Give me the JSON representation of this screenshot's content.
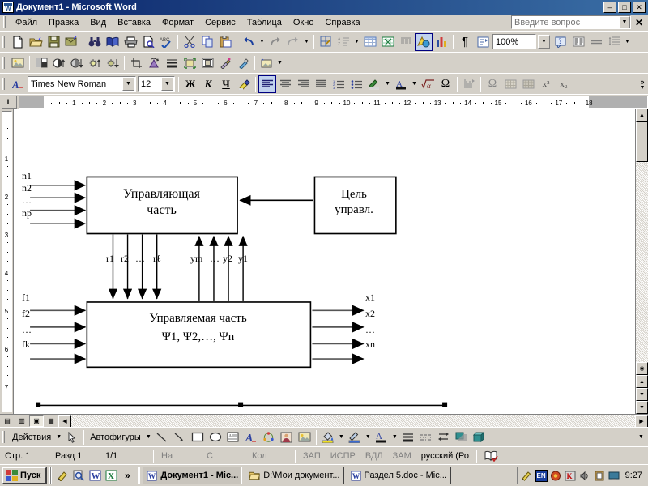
{
  "window": {
    "title": "Документ1 - Microsoft Word",
    "app_icon": "word-document-icon",
    "minimize": "–",
    "maximize": "□",
    "close": "✕"
  },
  "menu": {
    "items": [
      {
        "label": "Файл",
        "accel": "Ф"
      },
      {
        "label": "Правка",
        "accel": "р"
      },
      {
        "label": "Вид",
        "accel": "В"
      },
      {
        "label": "Вставка",
        "accel": "с"
      },
      {
        "label": "Формат",
        "accel": "м"
      },
      {
        "label": "Сервис",
        "accel": "е"
      },
      {
        "label": "Таблица",
        "accel": "Т"
      },
      {
        "label": "Окно",
        "accel": "О"
      },
      {
        "label": "Справка",
        "accel": "С"
      }
    ],
    "ask_placeholder": "Введите вопрос",
    "close_doc": "✕"
  },
  "standard_toolbar": {
    "buttons": [
      {
        "name": "new-document-icon"
      },
      {
        "name": "open-folder-icon"
      },
      {
        "name": "save-icon"
      },
      {
        "name": "email-icon"
      },
      {
        "name": "search-binoculars-icon"
      },
      {
        "name": "read-book-icon"
      },
      {
        "name": "print-icon"
      },
      {
        "name": "print-preview-icon"
      },
      {
        "name": "spelling-check-icon"
      },
      {
        "name": "cut-scissors-icon"
      },
      {
        "name": "copy-icon"
      },
      {
        "name": "paste-clipboard-icon"
      },
      {
        "name": "undo-icon"
      },
      {
        "name": "redo-icon"
      },
      {
        "name": "insert-hyperlink-icon"
      },
      {
        "name": "tables-and-borders-icon"
      },
      {
        "name": "insert-table-icon"
      },
      {
        "name": "insert-excel-sheet-icon"
      },
      {
        "name": "columns-icon"
      },
      {
        "name": "drawing-icon"
      },
      {
        "name": "document-map-icon"
      },
      {
        "name": "show-formatting-marks-icon"
      },
      {
        "name": "research-icon"
      },
      {
        "name": "help-icon"
      },
      {
        "name": "reading-layout-icon"
      },
      {
        "name": "equals-icon"
      },
      {
        "name": "paragraph-spacing-icon"
      }
    ],
    "zoom_value": "100%"
  },
  "picture_toolbar": {
    "buttons": [
      {
        "name": "insert-picture-icon"
      },
      {
        "name": "color-mode-icon"
      },
      {
        "name": "more-contrast-icon"
      },
      {
        "name": "less-contrast-icon"
      },
      {
        "name": "more-brightness-icon"
      },
      {
        "name": "less-brightness-icon"
      },
      {
        "name": "crop-icon"
      },
      {
        "name": "rotate-left-icon"
      },
      {
        "name": "line-style-icon"
      },
      {
        "name": "compress-pictures-icon"
      },
      {
        "name": "text-wrapping-icon"
      },
      {
        "name": "format-picture-icon"
      },
      {
        "name": "set-transparent-color-icon"
      },
      {
        "name": "reset-picture-icon"
      }
    ]
  },
  "formatting_toolbar": {
    "styles_icon": "styles-and-formatting-icon",
    "font_name": "Times New Roman",
    "font_size": "12",
    "bold": "Ж",
    "italic": "К",
    "underline": "Ч",
    "highlight_icon": "highlighter-icon",
    "align_left_icon": "align-left-icon",
    "align_center_icon": "align-center-icon",
    "align_right_icon": "align-right-icon",
    "align_justify_icon": "align-justify-icon",
    "numbering_icon": "numbered-list-icon",
    "bullets_icon": "bulleted-list-icon",
    "border_color_icon": "border-pen-icon",
    "font_color_icon": "font-color-icon",
    "equation_icon": "square-root-alpha-icon",
    "omega_icon": "omega-symbol-icon",
    "matrix_icon": "matrix-icon",
    "omega2_icon": "omega-symbol-icon",
    "grid1_icon": "grid-icon",
    "grid2_icon": "grid-icon",
    "superscript": "x²",
    "subscript": "x₂",
    "overflow": "»"
  },
  "ruler": {
    "tab_selector": "L",
    "ticks": [
      "1",
      "2",
      "3",
      "4",
      "5",
      "6",
      "7",
      "8",
      "9",
      "10",
      "11",
      "12",
      "13",
      "14",
      "15",
      "16",
      "17",
      "18"
    ],
    "vertical_ticks": [
      "1",
      "2",
      "3",
      "4",
      "5",
      "6",
      "7"
    ]
  },
  "diagram": {
    "control_box": {
      "line1": "Управляющая",
      "line2": "часть"
    },
    "goal_box": {
      "line1": "Цель",
      "line2": "управл."
    },
    "plant_box": {
      "line1": "Управляемая часть",
      "line2": "Ψ1, Ψ2,…, Ψn"
    },
    "control_inputs": [
      "n1",
      "n2",
      "…",
      "np"
    ],
    "plant_inputs": [
      "f1",
      "f2",
      "…",
      "fk"
    ],
    "plant_outputs": [
      "x1",
      "x2",
      "…",
      "xn"
    ],
    "feedback_down": [
      "r1",
      "r2",
      "…",
      "rℓ"
    ],
    "feedback_up": [
      "ym",
      "…",
      "y2",
      "y1"
    ]
  },
  "drawing_toolbar": {
    "actions_label": "Действия",
    "autoshapes_label": "Автофигуры",
    "buttons": [
      {
        "name": "select-arrow-icon"
      },
      {
        "name": "line-icon"
      },
      {
        "name": "arrow-icon"
      },
      {
        "name": "rectangle-icon"
      },
      {
        "name": "oval-icon"
      },
      {
        "name": "text-box-icon"
      },
      {
        "name": "wordart-icon"
      },
      {
        "name": "diagram-icon"
      },
      {
        "name": "clip-art-icon"
      },
      {
        "name": "insert-picture-icon"
      },
      {
        "name": "fill-color-icon"
      },
      {
        "name": "line-color-icon"
      },
      {
        "name": "font-color-icon"
      },
      {
        "name": "line-style-icon"
      },
      {
        "name": "dash-style-icon"
      },
      {
        "name": "arrow-style-icon"
      },
      {
        "name": "shadow-style-icon"
      },
      {
        "name": "3d-style-icon"
      }
    ]
  },
  "status_bar": {
    "page": "Стр. 1",
    "section": "Разд 1",
    "pages": "1/1",
    "at": "На",
    "line": "Ст",
    "column": "Кол",
    "rec": "ЗАП",
    "trk": "ИСПР",
    "ext": "ВДЛ",
    "ovr": "ЗАМ",
    "language": "русский (Ро",
    "spell_icon": "spell-check-status-icon"
  },
  "taskbar": {
    "start_label": "Пуск",
    "quick_launch": [
      {
        "name": "show-desktop-icon"
      },
      {
        "name": "search-icon"
      },
      {
        "name": "word-icon"
      },
      {
        "name": "excel-icon"
      },
      {
        "name": "chevron-more-icon",
        "label": "»"
      }
    ],
    "tasks": [
      {
        "label": "Документ1 - Mic...",
        "icon": "word-icon",
        "active": true
      },
      {
        "label": "D:\\Мои документ...",
        "icon": "folder-icon",
        "active": false
      },
      {
        "label": "Раздел 5.doc - Mic...",
        "icon": "word-icon",
        "active": false
      }
    ],
    "tray": [
      {
        "name": "pencil-icon"
      },
      {
        "name": "language-indicator",
        "label": "EN"
      },
      {
        "name": "network-icon"
      },
      {
        "name": "antivirus-icon"
      },
      {
        "name": "volume-icon"
      },
      {
        "name": "clipboard-icon"
      },
      {
        "name": "monitor-icon"
      }
    ],
    "clock": "9:27"
  },
  "colors": {
    "titlebar_start": "#0a246a",
    "titlebar_end": "#3a6ea5",
    "chrome": "#d4d0c8",
    "selected_tool": "#c1d2ee",
    "page_white": "#ffffff"
  }
}
